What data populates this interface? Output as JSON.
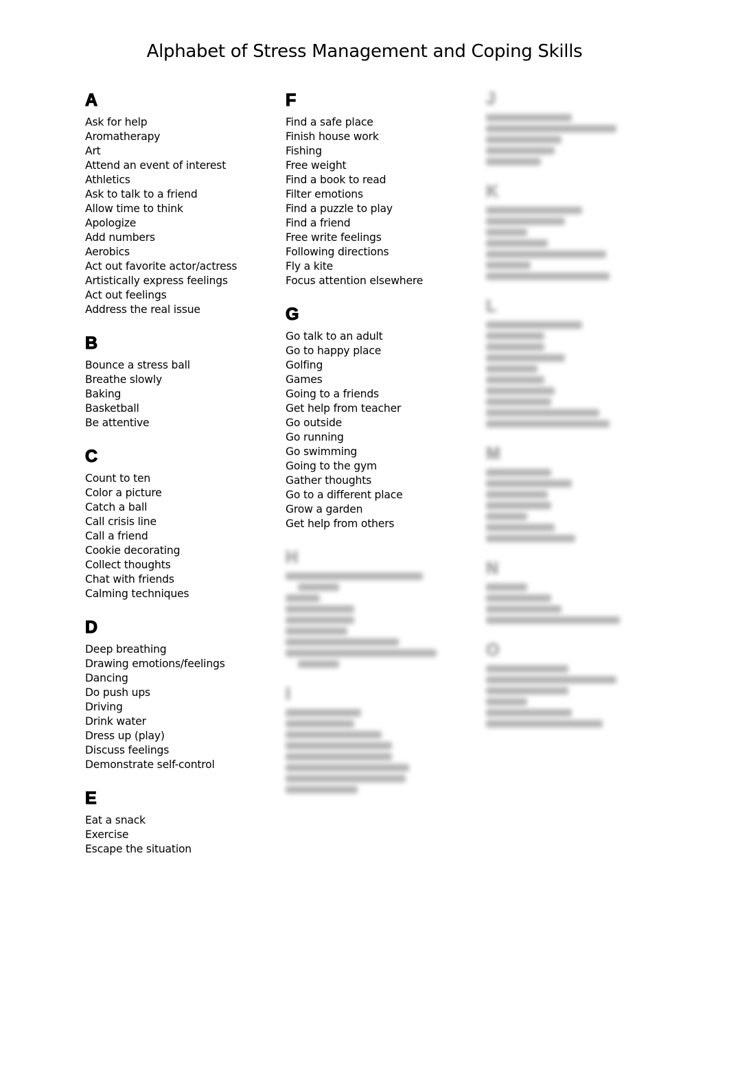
{
  "title": "Alphabet of Stress Management and Coping Skills",
  "sections": {
    "A": {
      "letter": "A",
      "items": [
        "Ask for help",
        "Aromatherapy",
        "Art",
        "Attend an event of interest",
        "Athletics",
        "Ask to talk to a friend",
        "Allow time to think",
        "Apologize",
        "Add numbers",
        "Aerobics",
        "Act out favorite actor/actress",
        "Artistically express feelings",
        "Act out feelings",
        "Address the real issue"
      ]
    },
    "B": {
      "letter": "B",
      "items": [
        "Bounce a stress ball",
        "Breathe slowly",
        "Baking",
        "Basketball",
        "Be attentive"
      ]
    },
    "C": {
      "letter": "C",
      "items": [
        "Count to ten",
        "Color a picture",
        "Catch a ball",
        "Call crisis line",
        "Call a friend",
        "Cookie decorating",
        "Collect thoughts",
        "Chat with friends",
        "Calming techniques"
      ]
    },
    "D": {
      "letter": "D",
      "items": [
        "Deep breathing",
        "Drawing emotions/feelings",
        "Dancing",
        "Do push ups",
        "Driving",
        "Drink water",
        "Dress up (play)",
        "Discuss feelings",
        "Demonstrate self-control"
      ]
    },
    "E": {
      "letter": "E",
      "items": [
        "Eat a snack",
        "Exercise",
        "Escape the situation"
      ]
    },
    "F": {
      "letter": "F",
      "items": [
        "Find a safe place",
        "Finish house work",
        "Fishing",
        "Free weight",
        "Find a book to read",
        "Filter emotions",
        "Find a puzzle to play",
        "Find a friend",
        "Free write feelings",
        "Following directions",
        "Fly a kite",
        "Focus attention elsewhere"
      ]
    },
    "G": {
      "letter": "G",
      "items": [
        "Go talk to an adult",
        "Go to happy place",
        "Golfing",
        "Games",
        "Going to a friends",
        "Get help from teacher",
        "Go outside",
        "Go running",
        "Go swimming",
        "Going to the gym",
        "Gather thoughts",
        "Go to a different place",
        "Grow a garden",
        "Get help from others"
      ]
    }
  },
  "blurred_sections": [
    "H",
    "I",
    "J",
    "K",
    "L",
    "M",
    "N",
    "O"
  ]
}
